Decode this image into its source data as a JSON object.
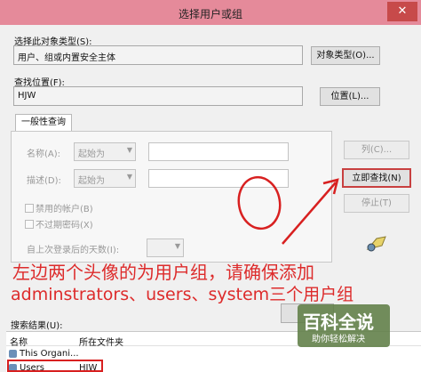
{
  "window": {
    "title": "选择用户或组",
    "close_glyph": "✕"
  },
  "object_type": {
    "label": "选择此对象类型(S):",
    "value": "用户、组或内置安全主体",
    "button": "对象类型(O)..."
  },
  "location": {
    "label": "查找位置(F):",
    "value": "HJW",
    "button": "位置(L)..."
  },
  "query": {
    "tab": "一般性查询",
    "name_label": "名称(A):",
    "name_mode": "起始为",
    "desc_label": "描述(D):",
    "desc_mode": "起始为",
    "disabled_accounts": "禁用的帐户(B)",
    "no_expire_pwd": "不过期密码(X)",
    "days_since_login": "自上次登录后的天数(I):"
  },
  "side_buttons": {
    "columns": "列(C)...",
    "find_now": "立即查找(N)",
    "stop": "停止(T)"
  },
  "annotation": {
    "line1": "左边两个头像的为用户组，请确保添加",
    "line2": "adminstrators、users、system三个用户组",
    "color": "#dd2b2b"
  },
  "results": {
    "label": "搜索结果(U):",
    "columns": [
      "名称",
      "所在文件夹"
    ],
    "rows": [
      {
        "name": "This Organi...",
        "folder": ""
      },
      {
        "name": "Users",
        "folder": "HJW"
      }
    ]
  },
  "watermark": {
    "title": "百科全说",
    "subtitle": "助你轻松解决"
  },
  "colors": {
    "titlebar": "#e58a9a",
    "close": "#c74a4a",
    "focus_border": "#c84040"
  }
}
